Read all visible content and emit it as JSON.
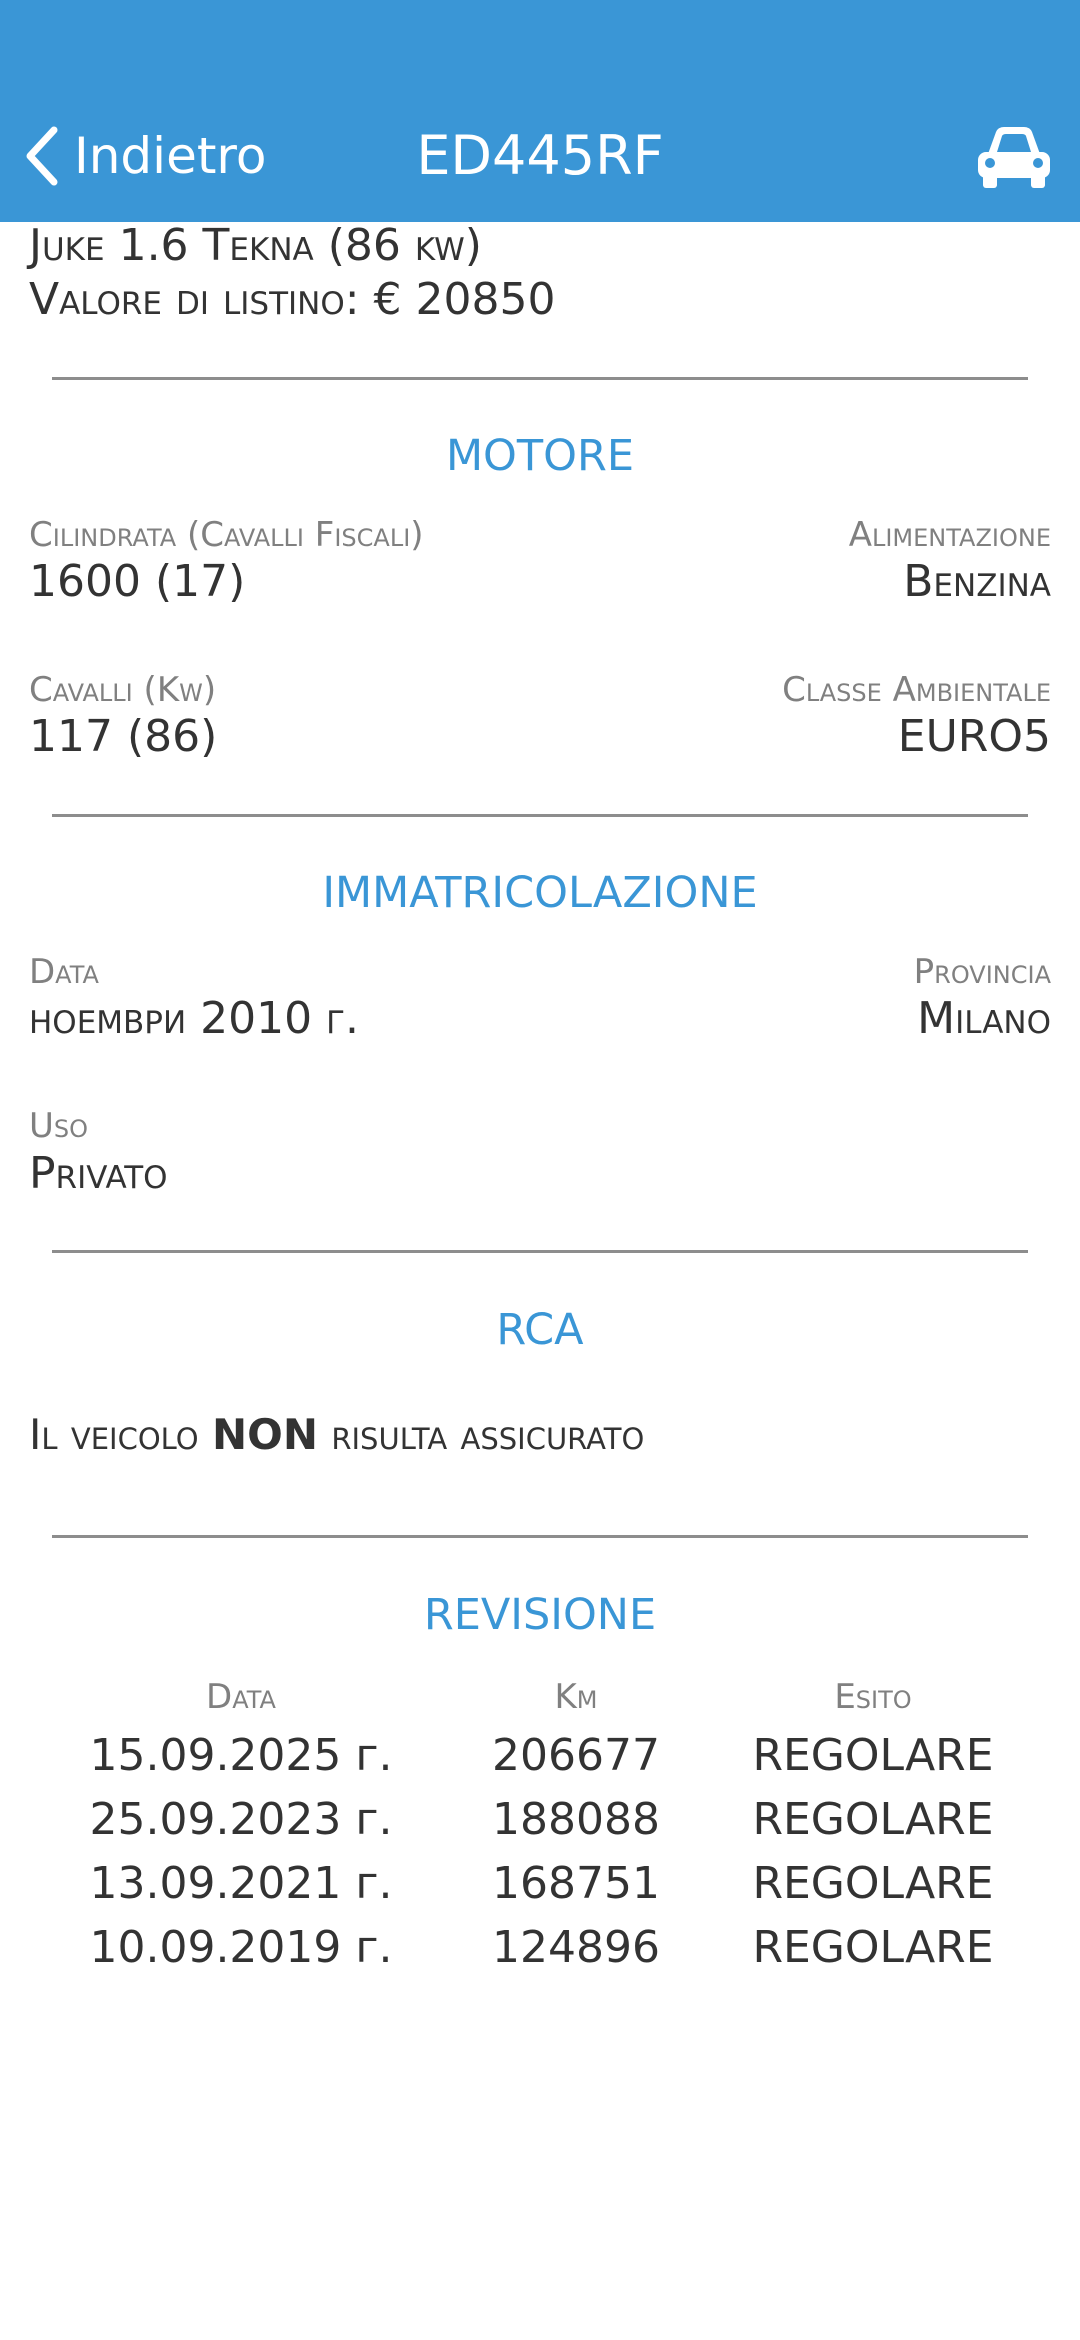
{
  "header": {
    "back_label": "Indietro",
    "title": "ED445RF",
    "back_icon": "chevron-left-icon",
    "action_icon": "car-icon",
    "color": "#3a96d6"
  },
  "vehicle": {
    "model": "Juke 1.6 Tekna (86 kw)",
    "list_value": "Valore di listino: € 20850"
  },
  "motore": {
    "title": "MOTORE",
    "cilindrata_label": "Cilindrata (Cavalli Fiscali)",
    "cilindrata_value": "1600 (17)",
    "alimentazione_label": "Alimentazione",
    "alimentazione_value": "Benzina",
    "cavalli_label": "Cavalli (Kw)",
    "cavalli_value": "117 (86)",
    "classe_label": "Classe Ambientale",
    "classe_value": "EURO5"
  },
  "immatricolazione": {
    "title": "IMMATRICOLAZIONE",
    "data_label": "Data",
    "data_value": "ноември 2010 г.",
    "provincia_label": "Provincia",
    "provincia_value": "Milano",
    "uso_label": "Uso",
    "uso_value": "Privato"
  },
  "rca": {
    "title": "RCA",
    "text_before": "Il veicolo ",
    "text_bold": "NON",
    "text_after": " risulta assicurato"
  },
  "revisione": {
    "title": "REVISIONE",
    "columns": [
      "Data",
      "Km",
      "Esito"
    ],
    "rows": [
      [
        "15.09.2025 г.",
        "206677",
        "REGOLARE"
      ],
      [
        "25.09.2023 г.",
        "188088",
        "REGOLARE"
      ],
      [
        "13.09.2021 г.",
        "168751",
        "REGOLARE"
      ],
      [
        "10.09.2019 г.",
        "124896",
        "REGOLARE"
      ]
    ]
  }
}
